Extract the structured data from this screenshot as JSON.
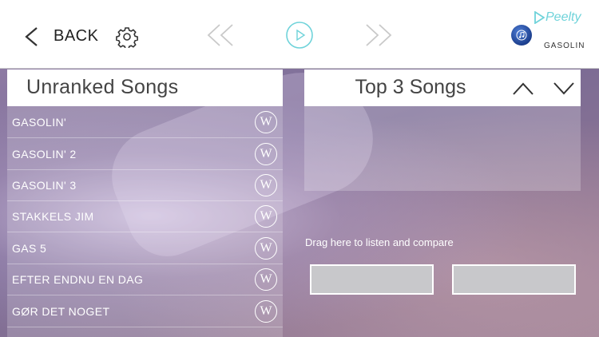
{
  "toolbar": {
    "back_label": "BACK",
    "brand_name": "Peelty",
    "artist": "GASOLIN",
    "accent_color": "#5ccfd6"
  },
  "icons": {
    "back": "chevron-left-icon",
    "settings": "gear-icon",
    "rewind": "rewind-icon",
    "play": "play-icon",
    "forward": "fast-forward-icon",
    "music": "music-note-icon"
  },
  "unranked": {
    "title": "Unranked Songs",
    "songs": [
      {
        "name": "GASOLIN'",
        "w_label": "W"
      },
      {
        "name": "GASOLIN' 2",
        "w_label": "W"
      },
      {
        "name": "GASOLIN' 3",
        "w_label": "W"
      },
      {
        "name": "STAKKELS JIM",
        "w_label": "W"
      },
      {
        "name": "GAS 5",
        "w_label": "W"
      },
      {
        "name": "EFTER ENDNU EN DAG",
        "w_label": "W"
      },
      {
        "name": "GØR DET NOGET",
        "w_label": "W"
      }
    ]
  },
  "top3": {
    "title": "Top 3 Songs"
  },
  "compare": {
    "label": "Drag here to listen and compare"
  }
}
